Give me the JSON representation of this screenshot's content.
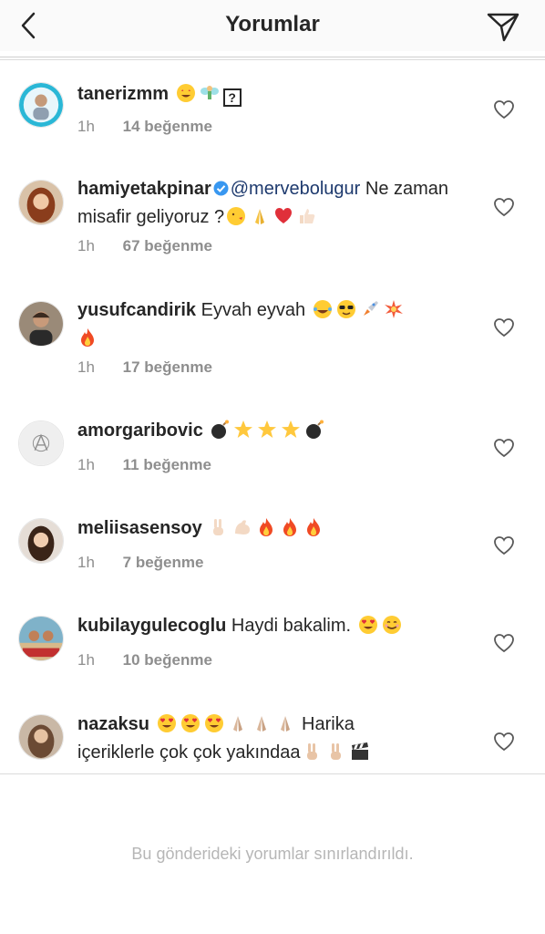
{
  "header": {
    "title": "Yorumlar"
  },
  "comments": [
    {
      "username": "tanerizmm",
      "text": "",
      "time": "1h",
      "likes": "14 beğenme"
    },
    {
      "username": "hamiyetakpinar",
      "mention": "@mervebolugur",
      "text": " Ne zaman misafir geliyoruz ?",
      "time": "1h",
      "likes": "67 beğenme"
    },
    {
      "username": "yusufcandirik",
      "text": " Eyvah eyvah ",
      "time": "1h",
      "likes": "17 beğenme"
    },
    {
      "username": "amorgaribovic",
      "text": " ",
      "time": "1h",
      "likes": "11 beğenme"
    },
    {
      "username": "meliisasensoy",
      "text": " ",
      "time": "1h",
      "likes": "7 beğenme"
    },
    {
      "username": "kubilaygulecoglu",
      "text": " Haydi bakalim. ",
      "time": "1h",
      "likes": "10 beğenme"
    },
    {
      "username": "nazaksu",
      "text1": " Harika",
      "text2": "içeriklerle çok çok yakındaa"
    }
  ],
  "footer": {
    "restricted_text": "Bu gönderideki yorumlar sınırlandırıldı."
  },
  "colors": {
    "mention": "#1e3a6e",
    "muted": "#8e8e8e",
    "footer_text": "#b6b6b6"
  }
}
